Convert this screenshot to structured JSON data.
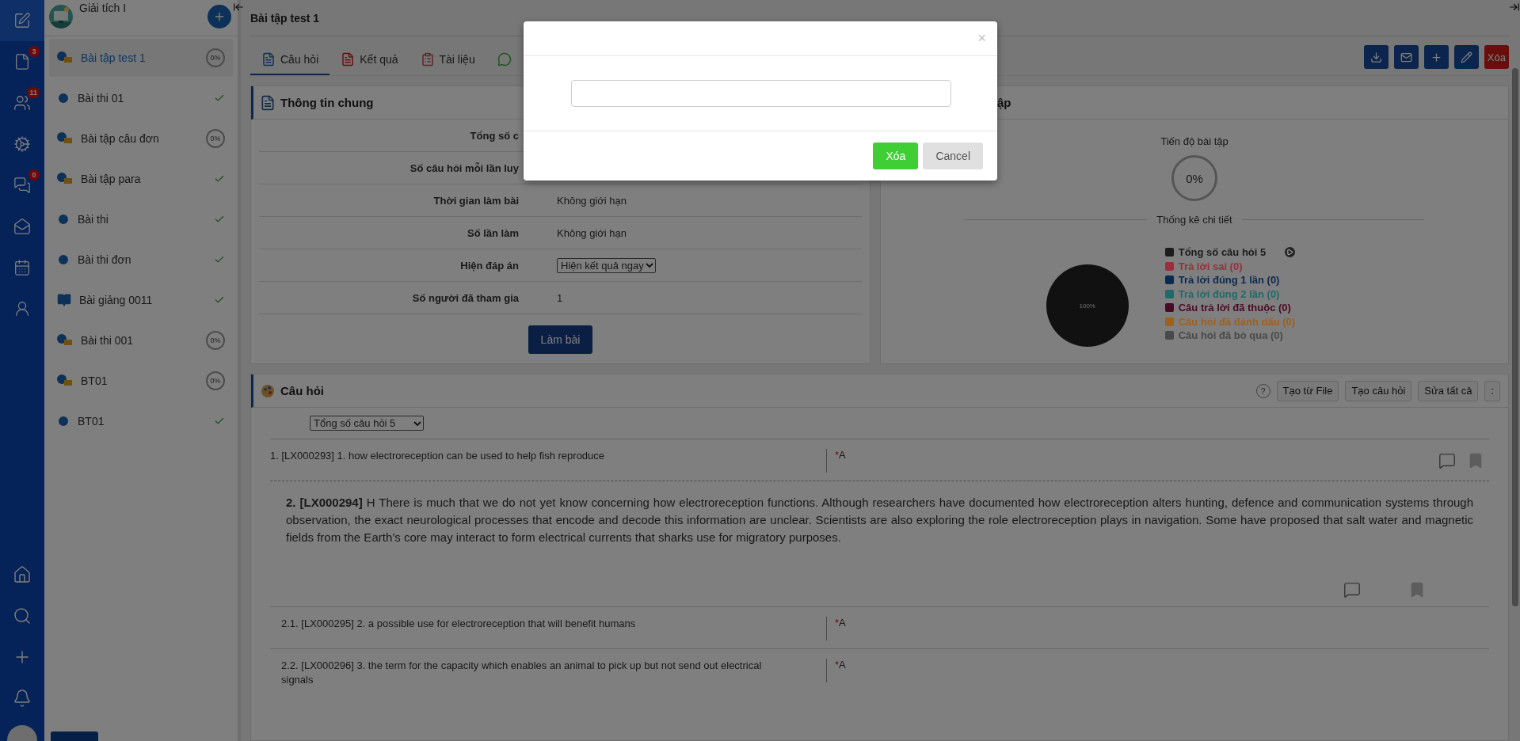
{
  "nav": {
    "top_items": [
      {
        "kind": "edit",
        "selected": true
      },
      {
        "kind": "file",
        "selected": false,
        "badge": "3"
      },
      {
        "kind": "users",
        "selected": false,
        "badge": "11"
      },
      {
        "kind": "settings",
        "selected": false
      },
      {
        "kind": "chat",
        "selected": false,
        "badge": "0"
      },
      {
        "kind": "mail",
        "selected": false
      },
      {
        "kind": "calendar",
        "selected": false
      },
      {
        "kind": "report",
        "selected": false
      }
    ],
    "bottom_items": [
      {
        "kind": "home"
      },
      {
        "kind": "search"
      },
      {
        "kind": "add"
      },
      {
        "kind": "bell"
      }
    ]
  },
  "sidebar": {
    "course": "Giải tích I",
    "items": [
      {
        "kind": "quiz",
        "label": "Bài tập test 1",
        "selected": true,
        "completed": false,
        "progress": "0%"
      },
      {
        "kind": "exam",
        "label": "Bài thi 01",
        "selected": false,
        "completed": true
      },
      {
        "kind": "quiz",
        "label": "Bài tập câu đơn",
        "selected": false,
        "completed": false,
        "progress": "0%"
      },
      {
        "kind": "quiz",
        "label": "Bài tập para",
        "selected": false,
        "completed": true
      },
      {
        "kind": "exam",
        "label": "Bài thi",
        "selected": false,
        "completed": true
      },
      {
        "kind": "exam",
        "label": "Bài thi đơn",
        "selected": false,
        "completed": true
      },
      {
        "kind": "lecture",
        "label": "Bài giảng 0011",
        "selected": false,
        "completed": true
      },
      {
        "kind": "quiz",
        "label": "Bài thi 001",
        "selected": false,
        "completed": false,
        "progress": "0%"
      },
      {
        "kind": "quiz",
        "label": "BT01",
        "selected": false,
        "completed": false,
        "progress": "0%"
      },
      {
        "kind": "exam",
        "label": "BT01",
        "selected": false,
        "completed": true
      }
    ]
  },
  "page": {
    "title": "Bài tập test 1"
  },
  "tabs": [
    {
      "kind": "questions",
      "label": "Câu hỏi",
      "selected": true
    },
    {
      "kind": "results",
      "label": "Kết quả",
      "selected": false
    },
    {
      "kind": "docs",
      "label": "Tài liệu",
      "selected": false
    },
    {
      "kind": "discussion",
      "selected": false
    }
  ],
  "toolbar": [
    {
      "kind": "download"
    },
    {
      "kind": "mail"
    },
    {
      "kind": "add"
    },
    {
      "kind": "edit"
    },
    {
      "kind": "delete",
      "label": "Xóa"
    }
  ],
  "info": {
    "title": "Thông tin chung",
    "rows": [
      {
        "kind": "text",
        "label": "Tổng số c"
      },
      {
        "kind": "text",
        "label": "Số câu hỏi mỗi lần luy"
      },
      {
        "kind": "text",
        "label": "Thời gian làm bài",
        "value": "Không giới hạn"
      },
      {
        "kind": "text",
        "label": "Số lần làm",
        "value": "Không giới hạn"
      },
      {
        "kind": "select",
        "label": "Hiện đáp án",
        "value": "Hiện kết quả ngay"
      },
      {
        "kind": "text",
        "label": "Số người đã tham gia",
        "value": "1"
      }
    ],
    "button": "Làm bài"
  },
  "stats": {
    "title": "ập",
    "progress_label": "Tiến độ bài tập",
    "progress": "0%",
    "detail_title": "Thống kê chi tiết",
    "pie_label": "100%",
    "legend": [
      {
        "label": "Tổng số câu hỏi 5",
        "color": "#1c1c1c",
        "play": true
      },
      {
        "label": "Trả lời sai (0)",
        "color": "#9a2e3c"
      },
      {
        "label": "Trả lời đúng 1 lần (0)",
        "color": "#0a2a52"
      },
      {
        "label": "Trả lời đúng 2 lần (0)",
        "color": "#1f6a6a"
      },
      {
        "label": "Câu trả lời đã thuộc (0)",
        "color": "#4a0a25"
      },
      {
        "label": "Câu hỏi đã đánh dấu (0)",
        "color": "#a0601a"
      },
      {
        "label": "Câu hỏi đã bỏ qua (0)",
        "color": "#4a4a4a"
      }
    ]
  },
  "questions": {
    "title": "Câu hỏi",
    "help": "?",
    "buttons": [
      "Tạo từ File",
      "Tạo câu hỏi",
      "Sửa tất cả"
    ],
    "more": ":",
    "filter": "Tổng số câu hỏi 5",
    "items": [
      {
        "kind": "single",
        "text": "1. [LX000293] 1. how electroreception can be used to help fish reproduce",
        "mark": "*",
        "answer": "A"
      },
      {
        "kind": "passage",
        "text": "**2. [LX000294]** H There is much that we do not yet know concerning how electroreception functions. Although researchers have documented how electroreception alters hunting, defence and communication systems through observation, the exact neurological processes that encode and decode this information are unclear. Scientists are also exploring the role electroreception plays in navigation. Some have proposed that salt water and magnetic fields from the Earth’s core may interact to form electrical currents that sharks use for migratory purposes."
      },
      {
        "kind": "sub",
        "text": "2.1. [LX000295] 2. a possible use for electroreception that will benefit humans",
        "mark": "*",
        "answer": "A"
      },
      {
        "kind": "sub",
        "text": "2.2. [LX000296] 3. the term for the capacity which enables an animal to pick up but not send out electrical signals",
        "mark": "*",
        "answer": "A"
      }
    ]
  },
  "modal": {
    "close": "×",
    "confirm": "Xóa",
    "cancel": "Cancel"
  }
}
